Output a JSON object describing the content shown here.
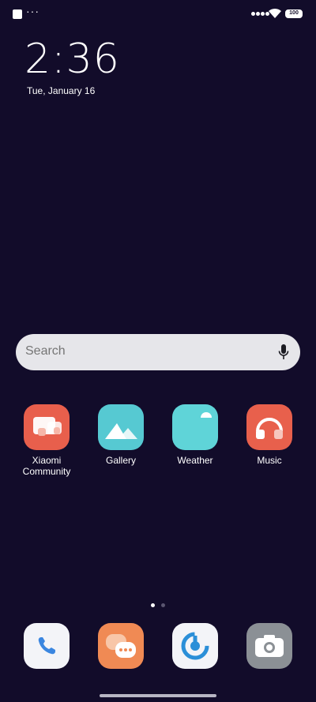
{
  "status_bar": {
    "dots": "···",
    "battery": "100"
  },
  "clock": {
    "time": "2:36",
    "date": "Tue, January 16"
  },
  "search": {
    "placeholder": "Search"
  },
  "apps": [
    {
      "label": "Xiaomi Community",
      "icon": "xiaomi-community-icon",
      "color": "#e85f4c"
    },
    {
      "label": "Gallery",
      "icon": "gallery-icon",
      "color": "#56c9d2"
    },
    {
      "label": "Weather",
      "icon": "weather-icon",
      "color": "#5fd4d8"
    },
    {
      "label": "Music",
      "icon": "music-icon",
      "color": "#e8604c"
    }
  ],
  "dock": [
    {
      "icon": "phone-icon",
      "color": "#f3f4f8"
    },
    {
      "icon": "messages-icon",
      "color": "#f08a54"
    },
    {
      "icon": "security-icon",
      "color": "#f3f4f8"
    },
    {
      "icon": "camera-icon",
      "color": "#8b9095"
    }
  ],
  "pager": {
    "active_page": 1,
    "page_count": 2
  }
}
